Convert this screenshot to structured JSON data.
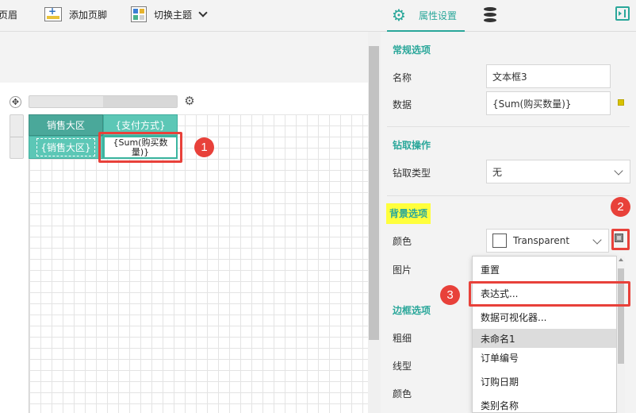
{
  "toolbar": {
    "header_label": "页眉",
    "add_footer_label": "添加页脚",
    "switch_theme_label": "切换主题"
  },
  "designer": {
    "table": {
      "header_cells": [
        "销售大区",
        "{支付方式}"
      ],
      "row_cells": [
        "{销售大区}",
        "{Sum(购买数量)}"
      ]
    }
  },
  "annotations": [
    "1",
    "2",
    "3"
  ],
  "panel": {
    "tab_label": "属性设置",
    "sections": {
      "general": "常规选项",
      "drill": "钻取操作",
      "background": "背景选项",
      "border": "边框选项"
    },
    "fields": {
      "name_label": "名称",
      "name_value": "文本框3",
      "data_label": "数据",
      "data_value": "{Sum(购买数量)}",
      "drill_type_label": "钻取类型",
      "drill_type_value": "无",
      "color_label": "颜色",
      "color_value": "Transparent",
      "image_label": "图片",
      "thickness_label": "粗细",
      "line_style_label": "线型",
      "border_color_label": "颜色"
    },
    "dropdown": {
      "items": [
        "重置",
        "表达式...",
        "数据可视化器...",
        "未命名1",
        "订单编号",
        "订购日期",
        "类别名称"
      ],
      "selected_index": 3
    }
  },
  "colors": {
    "accent": "#2aa79a",
    "header_cell": "#4aa89a",
    "cell": "#5cc7b6",
    "annotation": "#e8413a",
    "highlight": "#ffff3c"
  }
}
